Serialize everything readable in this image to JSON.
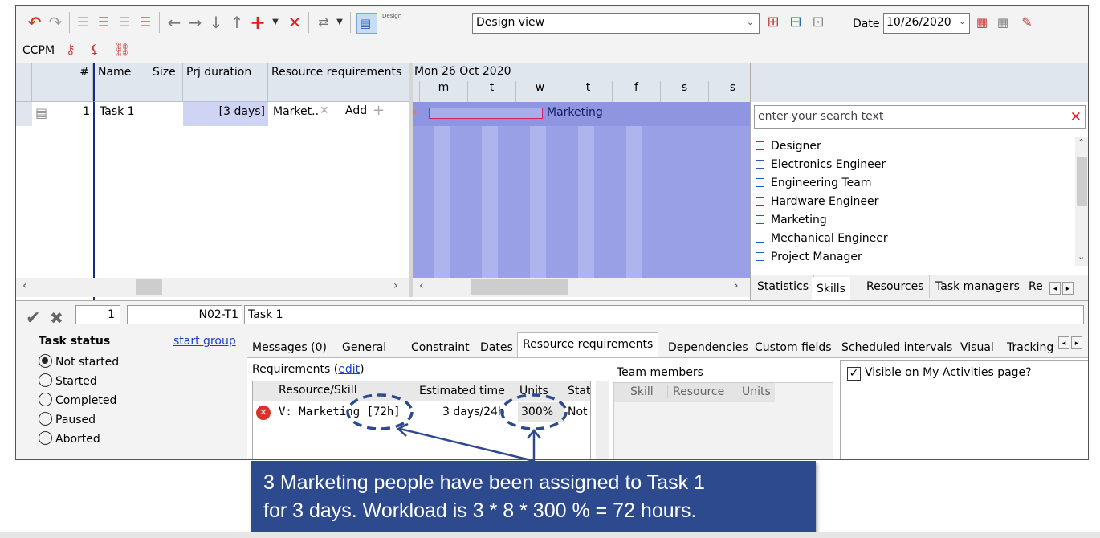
{
  "toolbar": {
    "view_select": "Design view",
    "date_label": "Date",
    "date_value": "10/26/2020",
    "design_icon_text": "Design"
  },
  "ccpm": {
    "label": "CCPM"
  },
  "grid": {
    "headers": {
      "num": "#",
      "name": "Name",
      "size": "Size",
      "duration": "Prj duration",
      "resources": "Resource requirements"
    },
    "rows": [
      {
        "num": "1",
        "name": "Task 1",
        "size": "",
        "duration": "[3 days]",
        "resource": "Market...",
        "add": "Add"
      }
    ]
  },
  "gantt": {
    "week_label": "Mon 26 Oct 2020",
    "days": [
      "m",
      "t",
      "w",
      "t",
      "f",
      "s",
      "s"
    ],
    "bar_label": "Marketing"
  },
  "skills_panel": {
    "search_placeholder": "enter your search text",
    "items": [
      "Designer",
      "Electronics Engineer",
      "Engineering Team",
      "Hardware Engineer",
      "Marketing",
      "Mechanical Engineer",
      "Project Manager"
    ],
    "tabs": [
      "Statistics",
      "Skills",
      "Resources",
      "Task managers",
      "Re"
    ],
    "active_tab": "Skills"
  },
  "detail": {
    "id_value": "1",
    "code": "N02-T1",
    "task_name": "Task 1",
    "task_status_title": "Task status",
    "start_group": "start group",
    "statuses": [
      "Not started",
      "Started",
      "Completed",
      "Paused",
      "Aborted"
    ],
    "selected_status": "Not started",
    "tabs": [
      "Messages (0)",
      "General",
      "Constraint",
      "Dates",
      "Resource requirements",
      "Dependencies",
      "Custom fields",
      "Scheduled intervals",
      "Visual",
      "Tracking"
    ],
    "active_tab": "Resource requirements",
    "requirements_label": "Requirements (",
    "edit_link": "edit",
    "requirements_close": ")",
    "req_headers": [
      "Resource/Skill",
      "Estimated time",
      "Units",
      "Stat"
    ],
    "req_row": {
      "skill": "V: Marketing [72h]",
      "time": "3 days/24h",
      "units": "300%",
      "status": "Not"
    },
    "team_members_label": "Team members",
    "team_headers": [
      "Skill",
      "Resource",
      "Units"
    ],
    "visible_label": "Visible on My Activities page?"
  },
  "callout": {
    "line1": "3 Marketing people have been assigned to Task 1",
    "line2": "for 3 days.  Workload is 3 * 8 * 300 % = 72 hours."
  },
  "colors": {
    "accent": "#2e4a8e",
    "gantt_bg": "#9aa0e6",
    "gantt_stripe": "#aeb4ee",
    "highlight": "#cfd4f5"
  }
}
